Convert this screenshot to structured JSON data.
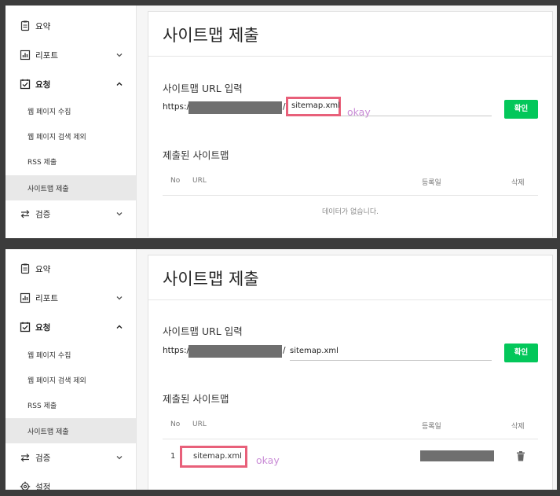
{
  "sidebar": {
    "summary": "요약",
    "report": "리포트",
    "request": "요청",
    "sub_items": [
      "웹 페이지 수집",
      "웹 페이지 검색 제외",
      "RSS 제출",
      "사이트맵 제출"
    ],
    "verify": "검증",
    "settings": "설정"
  },
  "main": {
    "title": "사이트맵 제출",
    "url_section_label": "사이트맵 URL 입력",
    "url_prefix": "https://",
    "slash": "/",
    "input_value": "sitemap.xml",
    "confirm_button": "확인",
    "submitted_label": "제출된 사이트맵",
    "columns": {
      "no": "No",
      "url": "URL",
      "date": "등록일",
      "delete": "삭제"
    },
    "empty_message": "데이터가 없습니다."
  },
  "row": {
    "no": "1",
    "url": "sitemap.xml"
  },
  "annotation": "okay",
  "colors": {
    "accent_green": "#03c75a",
    "highlight_border": "#e8607a",
    "annotation_text": "#c98bd6",
    "redaction": "#6f6f6f"
  },
  "icons": [
    "document-icon",
    "bar-chart-icon",
    "checkbox-icon",
    "swap-arrows-icon",
    "gear-icon",
    "chevron-down-icon",
    "chevron-up-icon",
    "trash-icon"
  ]
}
